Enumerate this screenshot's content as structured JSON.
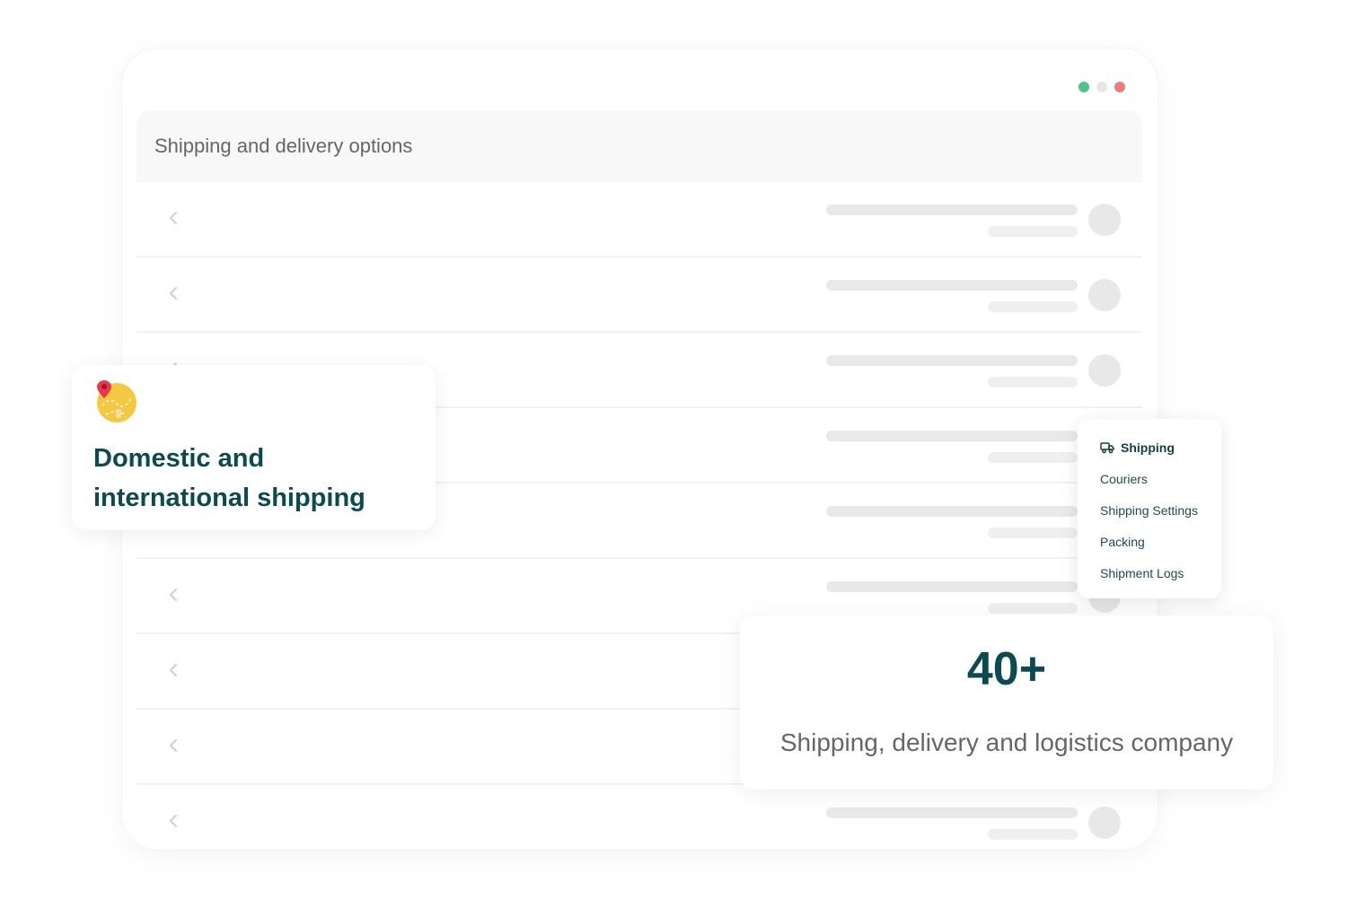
{
  "window": {
    "controls": [
      {
        "name": "green-dot",
        "color": "#4cc38a"
      },
      {
        "name": "gray-dot",
        "color": "#e6e6e6"
      },
      {
        "name": "red-dot",
        "color": "#f07b7b"
      }
    ],
    "header_title": "Shipping and delivery options",
    "row_count": 9
  },
  "domestic_card": {
    "icon": "globe-location-icon",
    "title": "Domestic and international shipping"
  },
  "menu": {
    "items": [
      {
        "label": "Shipping",
        "icon": "truck-icon",
        "active": true
      },
      {
        "label": "Couriers"
      },
      {
        "label": "Shipping Settings"
      },
      {
        "label": "Packing"
      },
      {
        "label": "Shipment Logs"
      }
    ]
  },
  "stat_card": {
    "number": "40+",
    "caption": "Shipping, delivery and logistics company"
  },
  "colors": {
    "brand_dark": "#0c4a52",
    "accent_yellow": "#f5c842",
    "pin_red": "#e8374e"
  }
}
